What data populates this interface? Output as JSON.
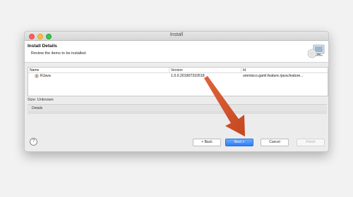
{
  "window": {
    "title": "Install"
  },
  "header": {
    "title": "Install Details",
    "description": "Review the items to be installed."
  },
  "table": {
    "columns": [
      "Name",
      "Version",
      "Id"
    ],
    "rows": [
      {
        "name": "RJava",
        "version": "1.0.0.201907310518",
        "id": "ummisco.gaml.feature.rjava.feature..."
      }
    ]
  },
  "size_label": "Size: Unknown",
  "details_label": "Details",
  "buttons": {
    "help": "?",
    "back": "< Back",
    "next": "Next >",
    "cancel": "Cancel",
    "finish": "Finish"
  },
  "colors": {
    "accent": "#2f7cf5",
    "annotation_arrow": "#d4542d"
  },
  "icons": [
    "install-graphic-icon",
    "plugin-icon",
    "help-icon",
    "arrow-annotation"
  ]
}
